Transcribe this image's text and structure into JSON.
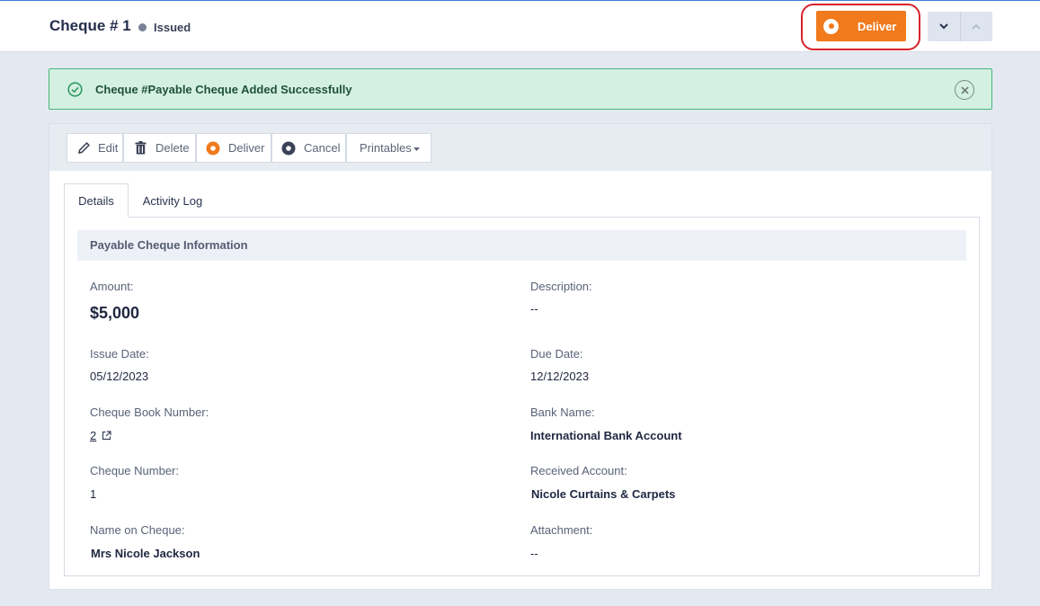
{
  "header": {
    "title": "Cheque # 1",
    "status": "Issued",
    "deliver_label": "Deliver"
  },
  "alert": {
    "message": "Cheque #Payable Cheque Added Successfully"
  },
  "toolbar": {
    "edit": "Edit",
    "delete": "Delete",
    "deliver": "Deliver",
    "cancel": "Cancel",
    "printables": "Printables"
  },
  "tabs": [
    {
      "label": "Details"
    },
    {
      "label": "Activity Log"
    }
  ],
  "details": {
    "section_title": "Payable Cheque Information",
    "amount_label": "Amount:",
    "amount": "$5,000",
    "description_label": "Description:",
    "description": "--",
    "issue_date_label": "Issue Date:",
    "issue_date": "05/12/2023",
    "due_date_label": "Due Date:",
    "due_date": "12/12/2023",
    "cheque_book_label": "Cheque Book Number:",
    "cheque_book": "2",
    "bank_name_label": "Bank Name:",
    "bank_name": "International Bank Account",
    "cheque_number_label": "Cheque Number:",
    "cheque_number": "1",
    "received_account_label": "Received Account:",
    "received_account": "Nicole Curtains & Carpets",
    "name_on_cheque_label": "Name on Cheque:",
    "name_on_cheque": "Mrs Nicole Jackson",
    "attachment_label": "Attachment:",
    "attachment": "--"
  },
  "colors": {
    "accent_orange": "#f07a1c",
    "success_bg": "#d4f0e2",
    "success_border": "#47b57a",
    "highlight_ring": "#d8222c"
  }
}
